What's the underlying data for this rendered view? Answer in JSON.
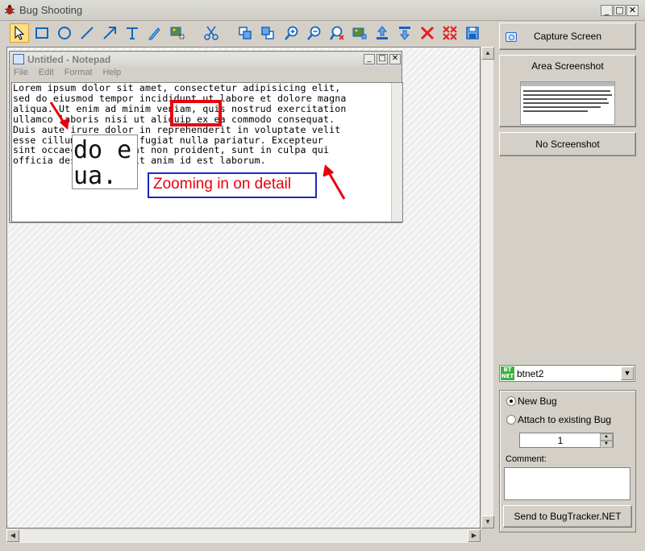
{
  "window": {
    "title": "Bug Shooting",
    "minimize": "_",
    "maximize": "□",
    "close": "✕"
  },
  "toolbar": {
    "tools": [
      {
        "name": "select-tool",
        "icon": "cursor-icon"
      },
      {
        "name": "rectangle-tool",
        "icon": "rectangle-icon"
      },
      {
        "name": "ellipse-tool",
        "icon": "ellipse-icon"
      },
      {
        "name": "line-tool",
        "icon": "line-icon"
      },
      {
        "name": "arrow-tool",
        "icon": "arrow-icon"
      },
      {
        "name": "text-tool",
        "icon": "text-icon"
      },
      {
        "name": "marker-tool",
        "icon": "marker-icon"
      },
      {
        "name": "zoom-area-tool",
        "icon": "zoom-area-icon"
      },
      {
        "name": "cut-tool",
        "icon": "scissors-icon"
      },
      {
        "name": "bring-forward-tool",
        "icon": "layer-forward-icon"
      },
      {
        "name": "send-backward-tool",
        "icon": "layer-backward-icon"
      },
      {
        "name": "zoom-in-tool",
        "icon": "zoom-in-icon"
      },
      {
        "name": "zoom-out-tool",
        "icon": "zoom-out-icon"
      },
      {
        "name": "zoom-reset-tool",
        "icon": "zoom-reset-icon"
      },
      {
        "name": "image-tool",
        "icon": "image-icon"
      },
      {
        "name": "upload-tool",
        "icon": "upload-icon"
      },
      {
        "name": "download-tool",
        "icon": "download-icon"
      },
      {
        "name": "delete-tool",
        "icon": "delete-icon"
      },
      {
        "name": "delete-all-tool",
        "icon": "delete-all-icon"
      },
      {
        "name": "save-tool",
        "icon": "save-icon"
      }
    ],
    "accent": "#1565c0",
    "delete_color": "#e02020"
  },
  "notepad": {
    "title": "Untitled - Notepad",
    "menu": [
      "File",
      "Edit",
      "Format",
      "Help"
    ],
    "lines": [
      "Lorem ipsum dolor sit amet, consectetur adipisicing elit,",
      "sed do eiusmod tempor incididunt ut labore et dolore magna",
      "aliqua. Ut enim ad minim veniam, quis nostrud exercitation",
      "ullamco laboris nisi ut aliquip ex ea commodo consequat.",
      "Duis aute irure dolor in reprehenderit in voluptate velit",
      "esse cillum dolore eu fugiat nulla pariatur. Excepteur",
      "sint occaecat cupidatat non proident, sunt in culpa qui",
      "officia deserunt mollit anim id est laborum."
    ]
  },
  "annotations": {
    "zoom_lines": [
      "do e",
      "ua."
    ],
    "label": "Zooming in on detail",
    "red": "#e8000e",
    "blue": "#1a28c8"
  },
  "panel": {
    "capture_screen": "Capture Screen",
    "area_screenshot": "Area Screenshot",
    "no_screenshot": "No Screenshot",
    "tracker": {
      "badge": "BT NET",
      "selected": "btnet2"
    },
    "new_bug": "New Bug",
    "attach_existing": "Attach to existing Bug",
    "bug_number": "1",
    "comment_label": "Comment:",
    "send_button": "Send to BugTracker.NET"
  }
}
